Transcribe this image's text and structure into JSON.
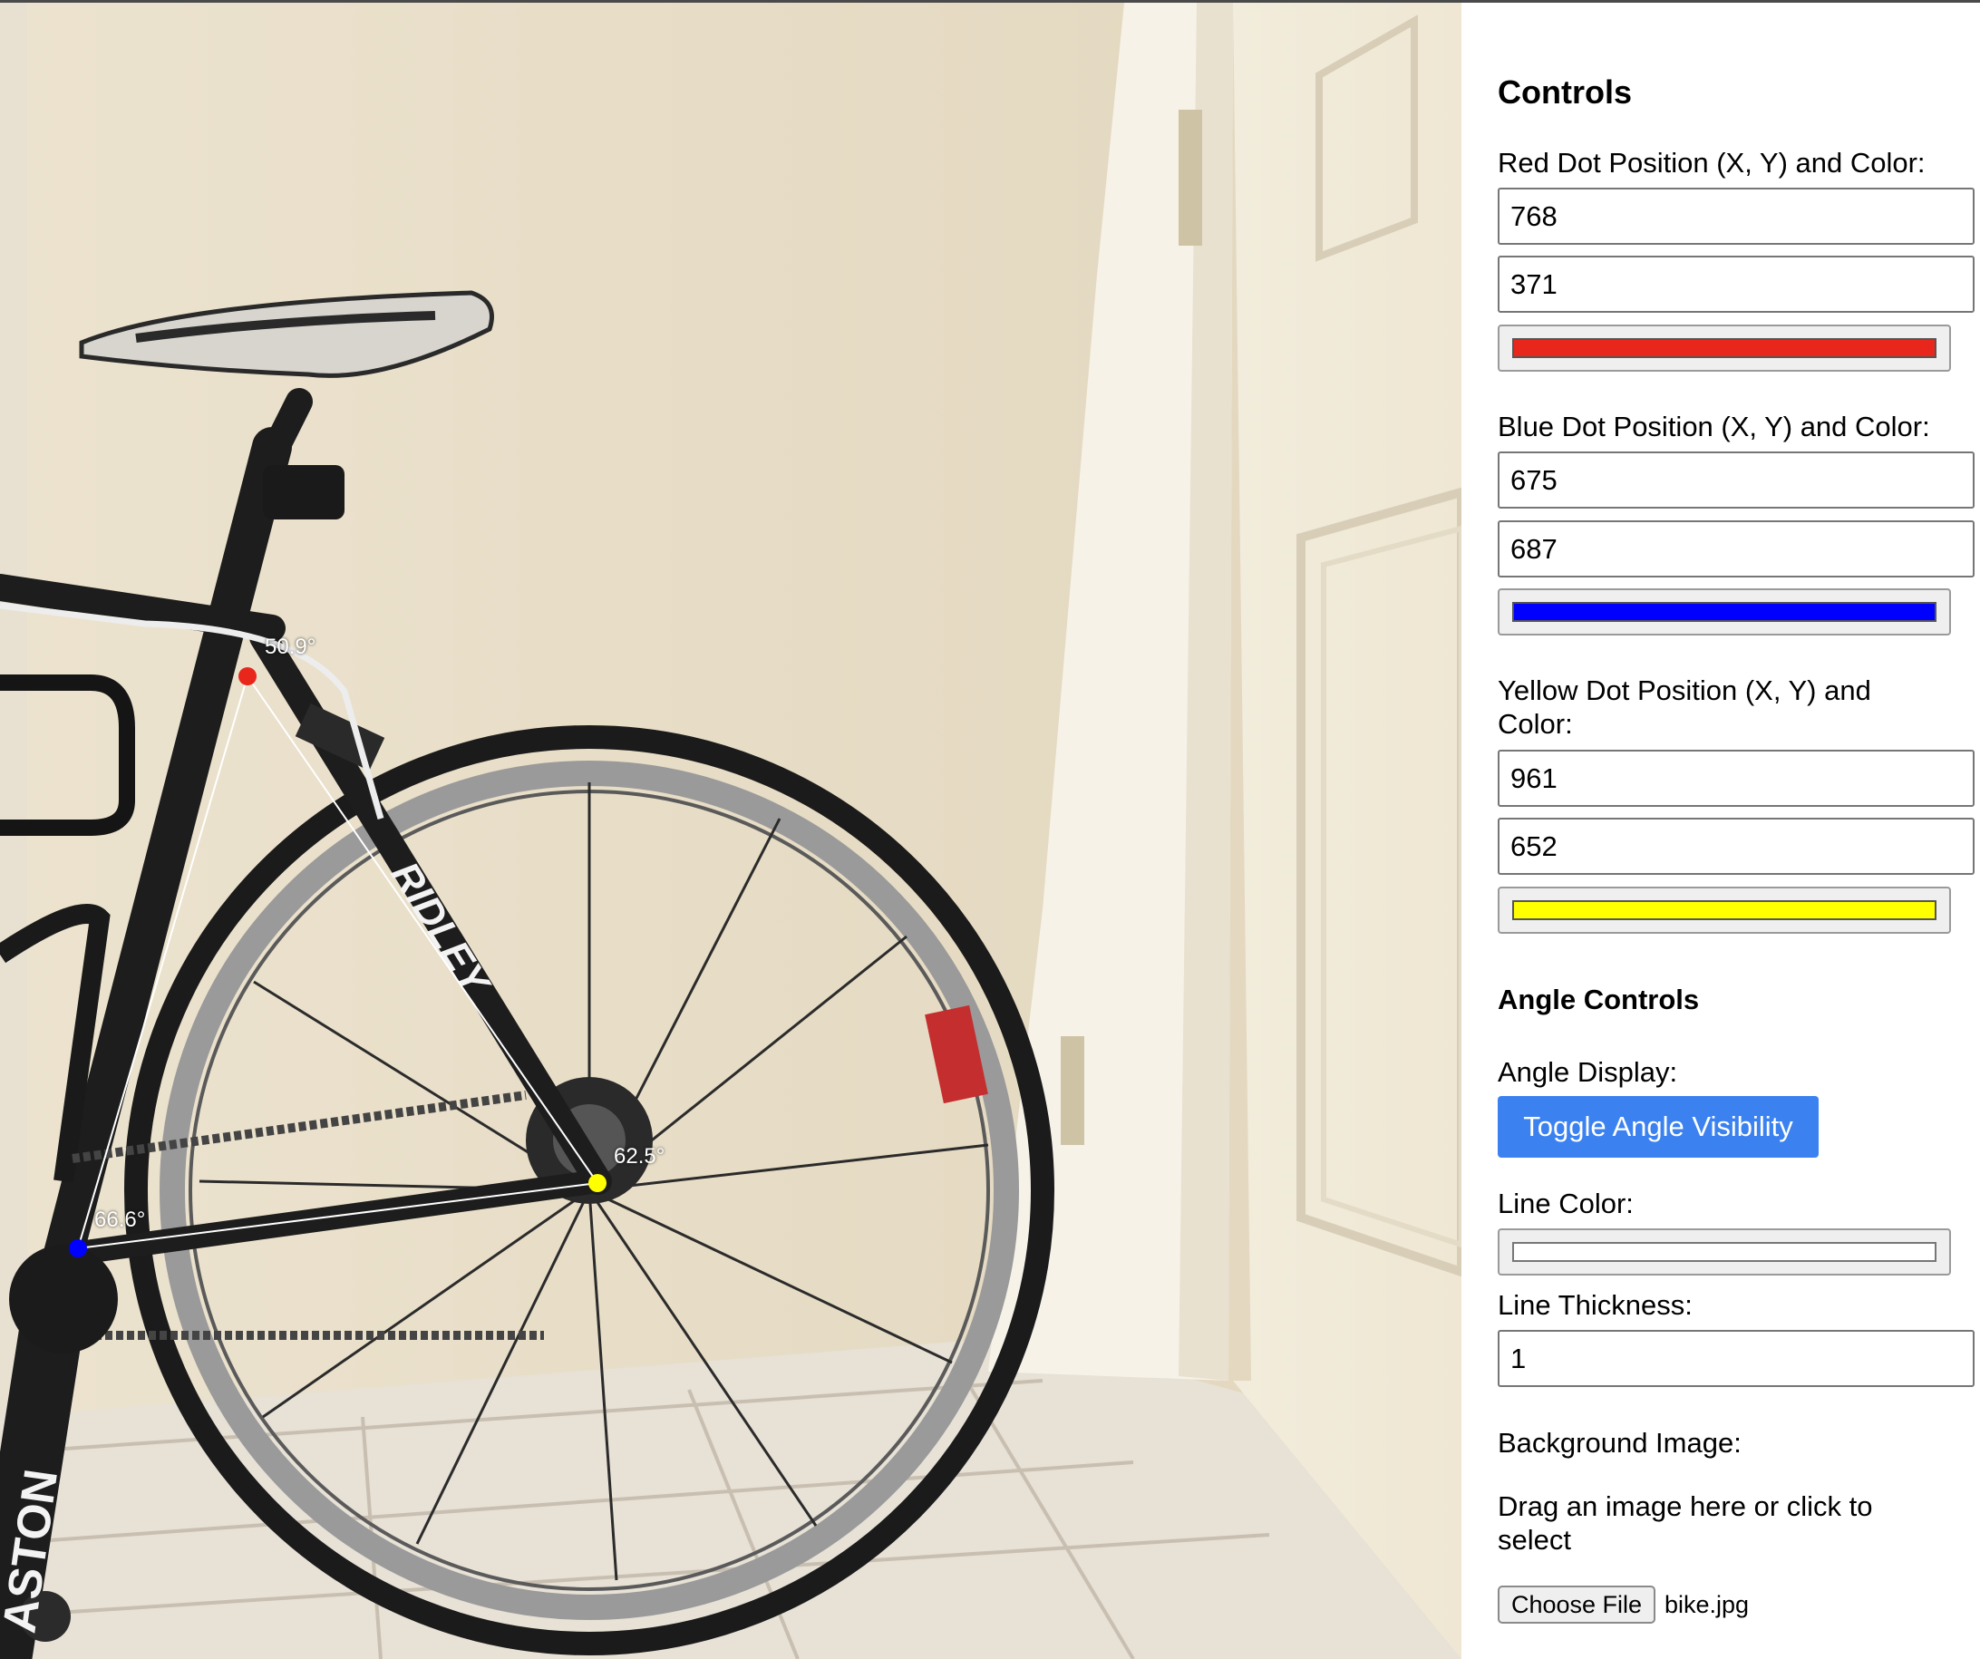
{
  "canvas": {
    "angles": {
      "red": "50.9°",
      "yellow": "62.5°",
      "blue": "66.6°"
    },
    "dot_colors": {
      "red": "#e8261c",
      "blue": "#0000ff",
      "yellow": "#ffff00"
    },
    "line_color": "#ffffff",
    "photo_logos": {
      "downtube": "RIDLEY",
      "chainstay": "ASTON"
    }
  },
  "controls": {
    "title": "Controls",
    "red": {
      "label": "Red Dot Position (X, Y) and Color:",
      "x": "768",
      "y": "371",
      "color": "#e8261c"
    },
    "blue": {
      "label": "Blue Dot Position (X, Y) and Color:",
      "x": "675",
      "y": "687",
      "color": "#0000ff"
    },
    "yellow": {
      "label_line1": "Yellow Dot Position (X, Y) and",
      "label_line2": "Color:",
      "x": "961",
      "y": "652",
      "color": "#ffff00"
    },
    "angle_controls": {
      "title": "Angle Controls",
      "display_label": "Angle Display:",
      "toggle_label": "Toggle Angle Visibility",
      "toggle_color": "#3b82f0"
    },
    "line_color_label": "Line Color:",
    "line_color_value": "#ffffff",
    "thickness_label": "Line Thickness:",
    "thickness_value": "1",
    "background": {
      "label": "Background Image:",
      "drop_line1": "Drag an image here or click to",
      "drop_line2": "select",
      "choose_label": "Choose File",
      "file_name": "bike.jpg"
    }
  }
}
